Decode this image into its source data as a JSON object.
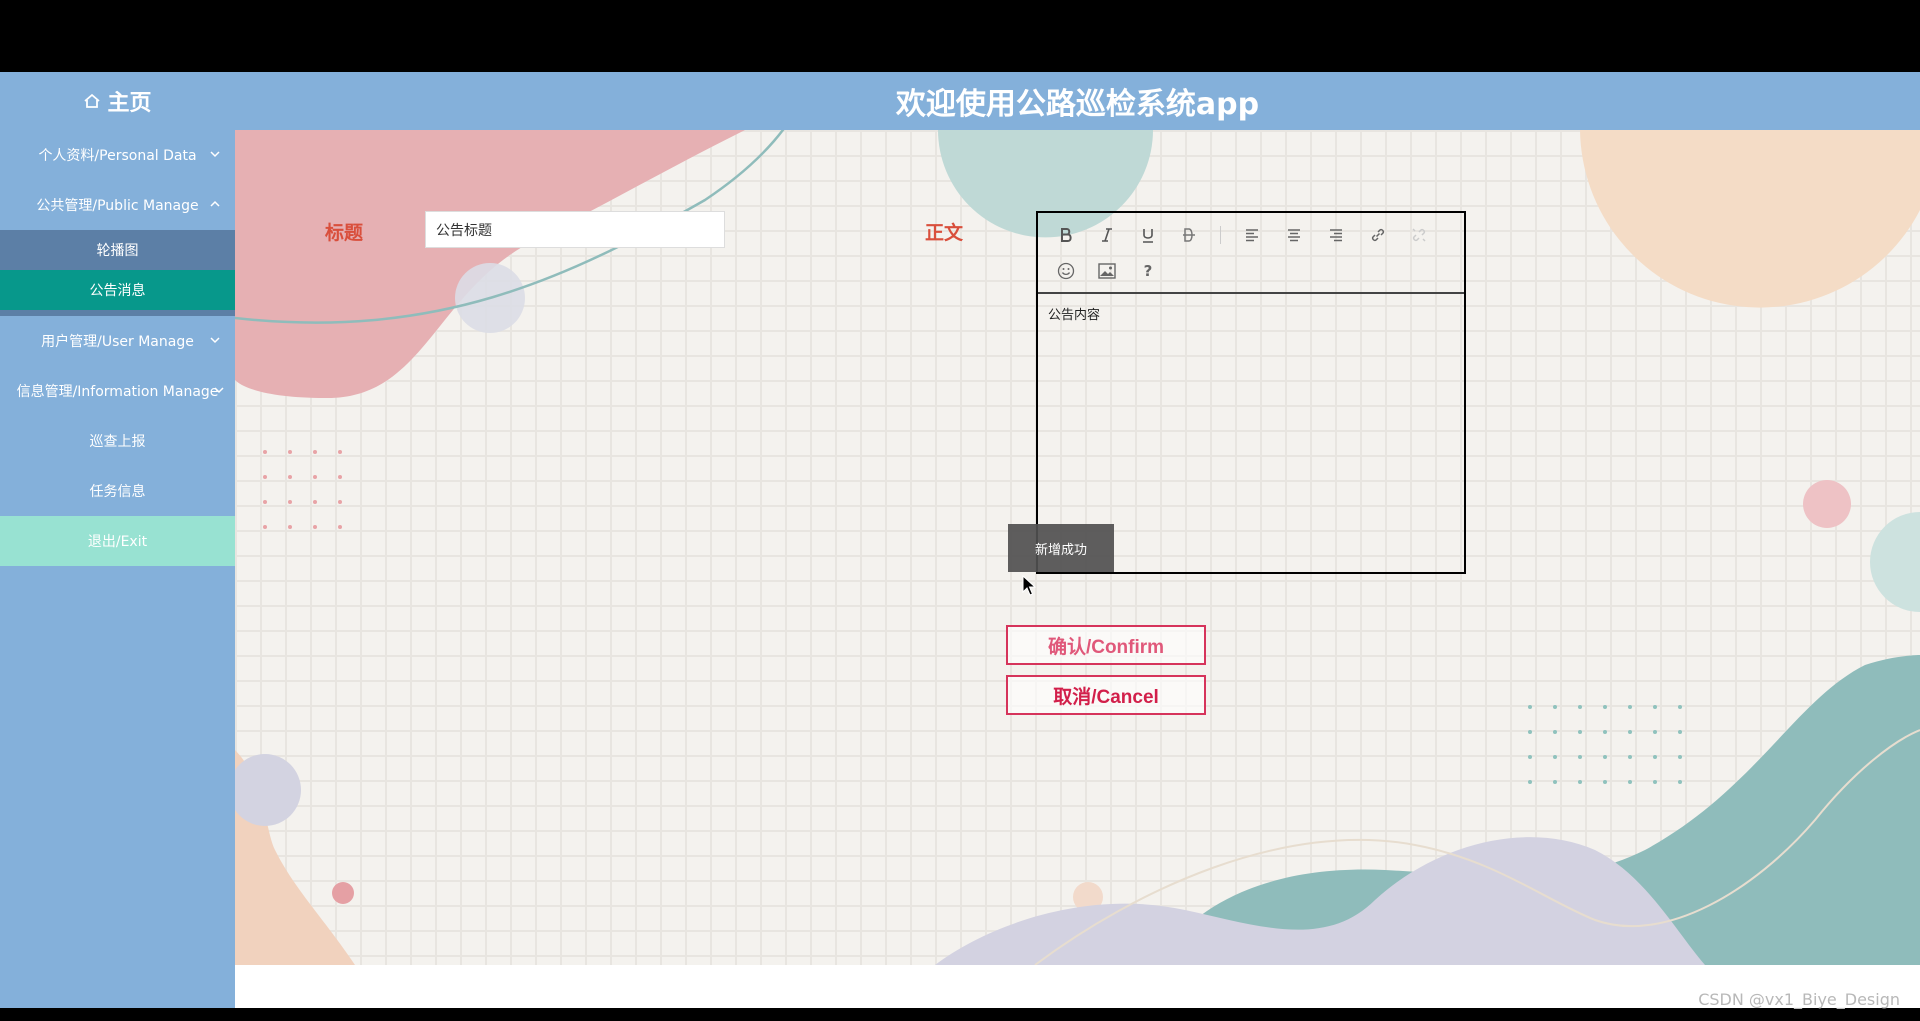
{
  "header": {
    "home_label": "主页",
    "app_title": "欢迎使用公路巡检系统app"
  },
  "sidebar": {
    "items": [
      {
        "label": "个人资料/Personal Data",
        "expanded": false
      },
      {
        "label": "公共管理/Public Manage",
        "expanded": true,
        "children": [
          {
            "label": "轮播图",
            "active": false
          },
          {
            "label": "公告消息",
            "active": true
          }
        ]
      },
      {
        "label": "用户管理/User Manage",
        "expanded": false
      },
      {
        "label": "信息管理/Information Manage",
        "expanded": false
      },
      {
        "label": "巡查上报"
      },
      {
        "label": "任务信息"
      },
      {
        "label": "退出/Exit"
      }
    ]
  },
  "form": {
    "title_label": "标题",
    "title_value": "公告标题",
    "body_label": "正文",
    "body_value": "公告内容",
    "toolbar_icons": [
      "bold-icon",
      "italic-icon",
      "underline-icon",
      "strikethrough-icon",
      "align-left-icon",
      "align-center-icon",
      "align-right-icon",
      "link-icon",
      "unlink-icon",
      "emoji-icon",
      "image-icon",
      "help-icon"
    ],
    "help_glyph": "?"
  },
  "toast": {
    "message": "新增成功"
  },
  "buttons": {
    "confirm_label": "确认/Confirm",
    "cancel_label": "取消/Cancel"
  },
  "watermark": "CSDN @vx1_Biye_Design",
  "colors": {
    "header_bg": "#84b0da",
    "active_item": "#07988b",
    "exit_bg": "#98e2d2",
    "label_red": "#d94f3c",
    "button_border": "#d6345b"
  }
}
